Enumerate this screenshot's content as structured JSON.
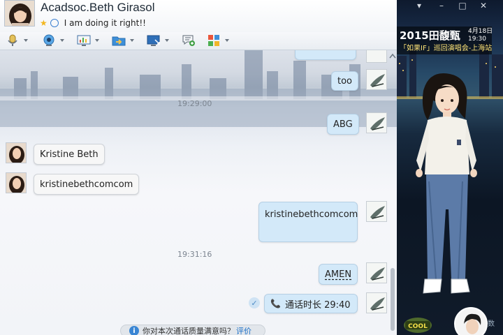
{
  "header": {
    "contact_name": "Acadsoc.Beth Girasol",
    "status_text": "I am doing it right!!"
  },
  "toolbar": {
    "items": [
      {
        "name": "voice-call",
        "icon": "microphone-icon"
      },
      {
        "name": "video-call",
        "icon": "webcam-icon"
      },
      {
        "name": "remote-assist",
        "icon": "monitor-chart-icon"
      },
      {
        "name": "send-file",
        "icon": "folder-arrow-icon"
      },
      {
        "name": "screen-share",
        "icon": "screen-arrow-icon"
      },
      {
        "name": "send-sms",
        "icon": "message-plus-icon"
      },
      {
        "name": "apps",
        "icon": "apps-grid-icon"
      }
    ]
  },
  "chat": {
    "messages": [
      {
        "dir": "out",
        "text": "too"
      },
      {
        "dir": "time",
        "text": "19:29:00"
      },
      {
        "dir": "out",
        "text": "ABG"
      },
      {
        "dir": "in",
        "text": "Kristine Beth"
      },
      {
        "dir": "in",
        "text": "kristinebethcomcom"
      },
      {
        "dir": "out",
        "text": "kristinebethcomcom"
      },
      {
        "dir": "time",
        "text": "19:31:16"
      },
      {
        "dir": "out",
        "text": "AMEN"
      },
      {
        "dir": "out",
        "text": "通话时长 29:40"
      }
    ],
    "survey": {
      "question": "你对本次通话质量满意吗？",
      "link": "评价"
    }
  },
  "right_panel": {
    "ad_title": "2015田馥甄",
    "ad_date_line1": "4月18日",
    "ad_date_line2": "19:30",
    "ad_subtitle": "「如果IF」巡回演唱会-上海站",
    "badge_text": "COOL",
    "side_char": "数"
  },
  "colors": {
    "incoming_bubble": "#f7f7f7",
    "outgoing_bubble": "#d3e9f9",
    "link": "#1a6fc8",
    "timestamp": "#7c8590"
  }
}
